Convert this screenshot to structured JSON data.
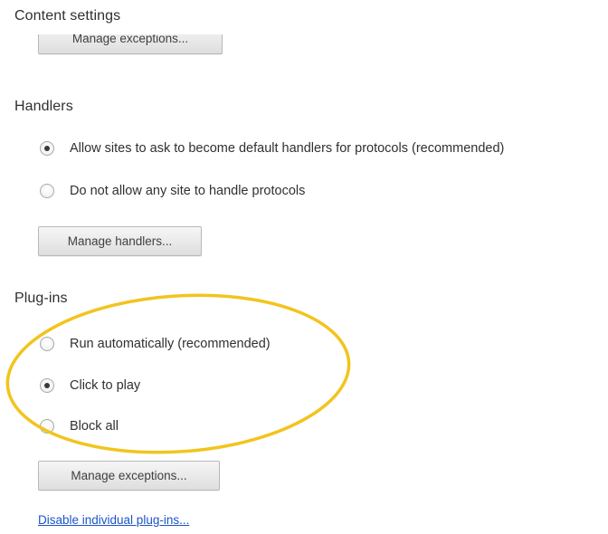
{
  "content_settings": {
    "title": "Content settings",
    "manage_exceptions_label": "Manage exceptions..."
  },
  "handlers": {
    "title": "Handlers",
    "options": [
      {
        "label": "Allow sites to ask to become default handlers for protocols (recommended)",
        "checked": true
      },
      {
        "label": "Do not allow any site to handle protocols",
        "checked": false
      }
    ],
    "manage_label": "Manage handlers..."
  },
  "plugins": {
    "title": "Plug-ins",
    "options": [
      {
        "label": "Run automatically (recommended)",
        "checked": false
      },
      {
        "label": "Click to play",
        "checked": true
      },
      {
        "label": "Block all",
        "checked": false
      }
    ],
    "manage_label": "Manage exceptions...",
    "disable_link": "Disable individual plug-ins..."
  },
  "colors": {
    "link": "#1a55c4",
    "highlight_annotation": "#f2c41d"
  }
}
